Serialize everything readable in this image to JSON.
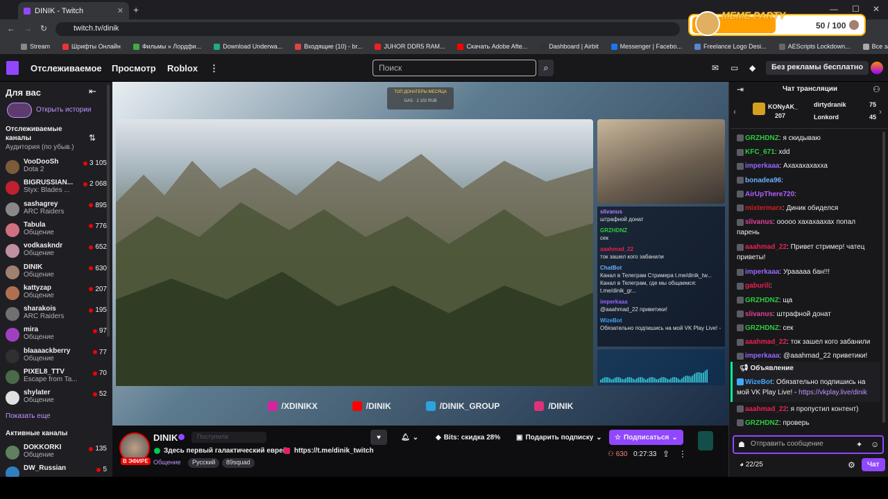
{
  "browser": {
    "tab_title": "DINIK - Twitch",
    "url": "twitch.tv/dinik",
    "bookmarks": [
      "Stream",
      "Шрифты Онлайн",
      "Фильмы » Лордфи...",
      "Download Underwa...",
      "Входящие (10) - br...",
      "JUHOR DDR5 RAM...",
      "Скачать Adobe Afte...",
      "Dashboard | Airbit",
      "Messenger | Facebo...",
      "Freelance Logo Desi...",
      "AEScripts Lockdown...",
      "Все закладки"
    ]
  },
  "meme_party": {
    "label": "MEME PARTY",
    "count": "50 / 100",
    "progress": 0.5
  },
  "nav": {
    "following": "Отслеживаемое",
    "browse": "Просмотр",
    "roblox": "Roblox",
    "search_placeholder": "Поиск",
    "noads": "Без рекламы бесплатно"
  },
  "sidebar": {
    "for_you": "Для вас",
    "stories": "Открыть истории",
    "followed_title": "Отслеживаемые каналы",
    "followed_sort": "Аудитория (по убыв.)",
    "channels": [
      {
        "name": "VooDooSh",
        "game": "Dota 2",
        "viewers": "3 105",
        "color": "#7a5c3a"
      },
      {
        "name": "BIGRUSSIAN...",
        "game": "Styx: Blades ...",
        "viewers": "2 068",
        "color": "#c02030"
      },
      {
        "name": "sashagrey",
        "game": "ARC Raiders",
        "viewers": "895",
        "color": "#888"
      },
      {
        "name": "Tabula",
        "game": "Общение",
        "viewers": "776",
        "color": "#d07080"
      },
      {
        "name": "vodkaskndr",
        "game": "Общение",
        "viewers": "652",
        "color": "#c090a0"
      },
      {
        "name": "DINIK",
        "game": "Общение",
        "viewers": "630",
        "color": "#a08070"
      },
      {
        "name": "kattyzap",
        "game": "Общение",
        "viewers": "207",
        "color": "#b07050"
      },
      {
        "name": "sharakois",
        "game": "ARC Raiders",
        "viewers": "195",
        "color": "#707070"
      },
      {
        "name": "mira",
        "game": "Общение",
        "viewers": "97",
        "color": "#a040c0"
      },
      {
        "name": "blaaaackberry",
        "game": "Общение",
        "viewers": "77",
        "color": "#303030"
      },
      {
        "name": "PIXEL8_TTV",
        "game": "Escape from Ta...",
        "viewers": "70",
        "color": "#4a6a4a"
      },
      {
        "name": "shylater",
        "game": "Общение",
        "viewers": "52",
        "color": "#e0e0e0"
      }
    ],
    "show_more": "Показать еще",
    "active_title": "Активные каналы",
    "active": [
      {
        "name": "DOKKORKI",
        "game": "Общение",
        "viewers": "135",
        "color": "#608060"
      },
      {
        "name": "DW_Russian",
        "game": "",
        "viewers": "5",
        "color": "#3080c0"
      }
    ]
  },
  "video": {
    "donors_title": "ТОП ДОНАТЕРЫ МЕСЯЦА",
    "donors_line": "GAS · 2 102 RUB",
    "socials": [
      "/XDINIKX",
      "/DINIK",
      "/DINIK_GROUP",
      "/DINIK"
    ],
    "overlay_chat": [
      {
        "user": "slivanus",
        "text": "штрафной донат",
        "color": "#b77dff"
      },
      {
        "user": "GRZHDNZ",
        "text": "сек",
        "color": "#2ecc40"
      },
      {
        "user": "aaahmad_22",
        "text": "ток зашел кого забанили",
        "color": "#eb2050"
      },
      {
        "user": "ChatBot",
        "text": "Канал в Телеграм Стримера t.me/dinik_tw... Канал в Телеграм, где мы общаемся: t.me/dinik_gr...",
        "color": "#6ab0ff"
      },
      {
        "user": "imperkaaa",
        "text": "@aaahmad_22 приветики!",
        "color": "#9966ff"
      },
      {
        "user": "WizeBot",
        "text": "Обязательно подпишись на мой VK Play Live! -",
        "color": "#3fa9ff"
      }
    ]
  },
  "channel": {
    "name": "DINIK",
    "follow": "Поступила",
    "live": "В ЭФИРЕ",
    "title": "Здесь первый галактический еврей",
    "link": "https://t.me/dinik_twitch",
    "tags": [
      "Общение",
      "Русский",
      "89squad"
    ],
    "viewers": "630",
    "uptime": "0:27:33",
    "bits": "Bits: скидка 28%",
    "gift": "Подарить подписку",
    "subscribe": "Подписаться"
  },
  "chat": {
    "header": "Чат трансляции",
    "leaderboard": [
      {
        "name": "KONyAK_",
        "value": "207"
      },
      {
        "name": "dirtydranik",
        "value": "75"
      },
      {
        "name": "Lonkord",
        "value": "45"
      }
    ],
    "messages": [
      {
        "user": "GRZHDNZ",
        "text": "я скидываю",
        "color": "#2ecc40"
      },
      {
        "user": "KFC_671",
        "text": "xdd",
        "color": "#2ecc40"
      },
      {
        "user": "imperkaaa",
        "text": "Ахахахахахха",
        "color": "#9966ff"
      },
      {
        "user": "bonadea96",
        "text": "",
        "color": "#6ab0ff"
      },
      {
        "user": "AirUpThere720",
        "text": "",
        "color": "#b060ff"
      },
      {
        "user": "mixtermarx",
        "text": "Диник обиделся",
        "color": "#cc2020"
      },
      {
        "user": "slivanus",
        "text": "ооооо хахахаахах попал парень",
        "color": "#e0409a"
      },
      {
        "user": "aaahmad_22",
        "text": "Привет стример! чатец приветы!",
        "color": "#eb2050"
      },
      {
        "user": "imperkaaa",
        "text": "Урааааа бан!!!",
        "color": "#9966ff"
      },
      {
        "user": "gaburili",
        "text": "",
        "color": "#eb2050"
      },
      {
        "user": "GRZHDNZ",
        "text": "ща",
        "color": "#2ecc40"
      },
      {
        "user": "slivanus",
        "text": "штрафной донат",
        "color": "#e0409a"
      },
      {
        "user": "GRZHDNZ",
        "text": "сек",
        "color": "#2ecc40"
      },
      {
        "user": "aaahmad_22",
        "text": "ток зашел кого забанили",
        "color": "#eb2050"
      },
      {
        "user": "imperkaaa",
        "text": "@aaahmad_22 приветики!",
        "color": "#9966ff"
      }
    ],
    "announcement_label": "Объявление",
    "announce_user": "WizeBot",
    "announce_text": "Обязательно подпишись на мой VK Play Live! -",
    "announce_link": "https://vkplay.live/dinik",
    "after": [
      {
        "user": "aaahmad_22",
        "text": "я пропустил контент)",
        "color": "#eb2050"
      },
      {
        "user": "GRZHDNZ",
        "text": "проверь",
        "color": "#2ecc40"
      }
    ],
    "input_placeholder": "Отправить сообщение",
    "points": "22/25",
    "send": "Чат"
  }
}
